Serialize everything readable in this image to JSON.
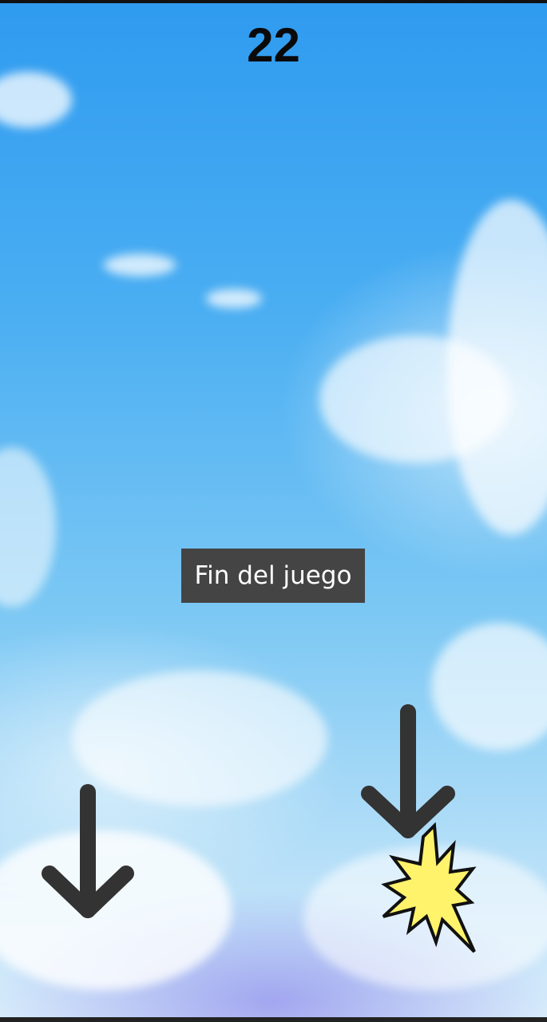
{
  "game": {
    "score": "22",
    "message": "Fin del juego"
  },
  "colors": {
    "sky_top": "#2f9bf0",
    "sky_bottom": "#d9ecfb",
    "arrow": "#333333",
    "toast_bg": "#444444",
    "toast_text": "#ffffff",
    "explosion_fill": "#fff36b",
    "explosion_stroke": "#111111"
  },
  "icons": {
    "left_arrow": "arrow-down-icon",
    "right_arrow": "arrow-down-icon",
    "explosion": "explosion-icon"
  }
}
